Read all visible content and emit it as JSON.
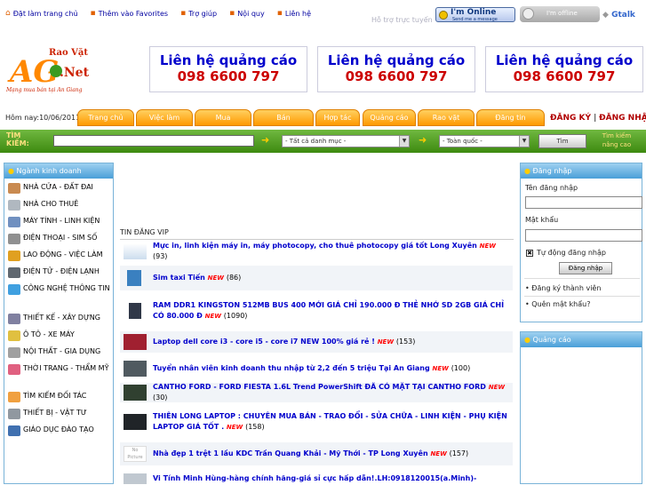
{
  "toplinks": [
    "Đặt làm trang chủ",
    "Thêm vào Favorites",
    "Trợ giúp",
    "Nội quy",
    "Liên hệ"
  ],
  "support_text": "Hỗ trợ trực tuyến",
  "online_badge": {
    "title": "I'm Online",
    "sub": "Send me a message"
  },
  "offline_badge": "I'm offline",
  "gtalk": "Gtalk",
  "logo": {
    "top": "Rao Vặt",
    "mid": "AG",
    "net": ".Net",
    "tagline": "Mạng mua bán tại An Giang"
  },
  "ads": [
    {
      "line1": "Liên hệ quảng cáo",
      "line2": "098 6600 797"
    },
    {
      "line1": "Liên hệ quảng cáo",
      "line2": "098 6600 797"
    },
    {
      "line1": "Liên hệ quảng cáo",
      "line2": "098 6600 797"
    }
  ],
  "today": "Hôm nay:10/06/2011",
  "nav": [
    "Trang chủ",
    "Việc làm",
    "Mua",
    "Bán",
    "Hợp tác",
    "Quảng cáo",
    "Rao vặt",
    "Đăng tin"
  ],
  "register": "ĐĂNG KÝ",
  "login_link": "ĐĂNG NHẬP",
  "search": {
    "label": "TÌM KIẾM:",
    "category": "- Tất cả danh mục -",
    "region": "- Toàn quốc -",
    "button": "Tìm",
    "advanced": "Tìm kiếm nâng cao"
  },
  "left_panel": {
    "title": "Ngành kinh doanh",
    "items": [
      "NHÀ CỬA - ĐẤT ĐAI",
      "NHÀ CHO THUÊ",
      "MÁY TÍNH - LINH KIỆN",
      "ĐIỆN THOẠI - SIM SỐ",
      "LAO ĐỘNG - VIỆC LÀM",
      "ĐIỆN TỬ - ĐIỆN LẠNH",
      "CÔNG NGHỆ THÔNG TIN",
      "THIẾT KẾ - XÂY DỰNG",
      "Ô TÔ - XE MÁY",
      "NỘI THẤT - GIA DỤNG",
      "THỜI TRANG - THẨM MỸ",
      "TÌM KIẾM ĐỐI TÁC",
      "THIẾT BỊ - VẬT TƯ",
      "GIÁO DỤC ĐÀO TẠO"
    ]
  },
  "vip_title": "TIN ĐĂNG VIP",
  "new_badge": "NEW",
  "vip_items": [
    {
      "title": "Mực in, linh kiện máy in, máy photocopy, cho thuê photocopy giá tốt Long Xuyên",
      "count": "(93)"
    },
    {
      "title": "Sim taxi Tiến",
      "count": "(86)"
    },
    {
      "title": "RAM DDR1 KINGSTON 512MB BUS 400 MỚI GIÁ CHỈ 190.000 Đ THẺ NHỚ SD 2GB GIÁ CHỈ CÓ 80.000 Đ",
      "count": "(1090)"
    },
    {
      "title": "Laptop dell core i3 - core i5 - core i7 NEW 100% giá rẻ !",
      "count": "(153)"
    },
    {
      "title": "Tuyển nhân viên kinh doanh thu nhập từ 2,2 đến 5 triệu Tại An Giang",
      "count": "(100)"
    },
    {
      "title": "CANTHO FORD - FORD FIESTA 1.6L Trend PowerShift ĐÃ CÓ MẶT TẠI CANTHO FORD",
      "count": "(30)"
    },
    {
      "title": "THIÊN LONG LAPTOP : CHUYÊN MUA BÁN - TRAO ĐỔI - SỬA CHỮA - LINH KIỆN - PHỤ KIỆN LAPTOP GIÁ TỐT .",
      "count": "(158)"
    },
    {
      "title": "Nhà đẹp 1 trệt 1 lầu KDC Trần Quang Khải - Mỹ Thới - TP Long Xuyên",
      "count": "(157)"
    },
    {
      "title": "Vi Tính Minh Hùng-hàng chính hãng-giá sỉ cực hấp dẫn!.LH:0918120015(a.Minh)-",
      "count": ""
    }
  ],
  "no_picture": "No Picture",
  "right_panel": {
    "title": "Đăng nhập",
    "username_label": "Tên đăng nhập",
    "password_label": "Mật khẩu",
    "remember": "Tự động đăng nhập",
    "login_button": "Đăng nhập",
    "register_link": "Đăng ký thành viên",
    "forgot_link": "Quên mật khẩu?",
    "ads_title": "Quảng cáo"
  }
}
